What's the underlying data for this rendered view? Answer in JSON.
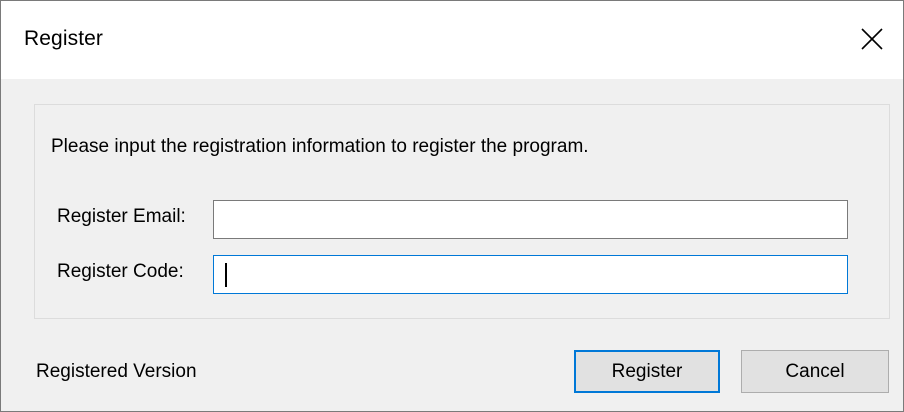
{
  "window": {
    "title": "Register",
    "close_icon": "close-icon"
  },
  "main": {
    "info_text": "Please input the registration information to register the program.",
    "email_label": "Register Email:",
    "email_value": "",
    "code_label": "Register Code:",
    "code_value": ""
  },
  "footer": {
    "status_text": "Registered Version",
    "register_label": "Register",
    "cancel_label": "Cancel"
  },
  "colors": {
    "focus_accent": "#0078d7",
    "dialog_background": "#f0f0f0",
    "button_face": "#e1e1e1"
  }
}
